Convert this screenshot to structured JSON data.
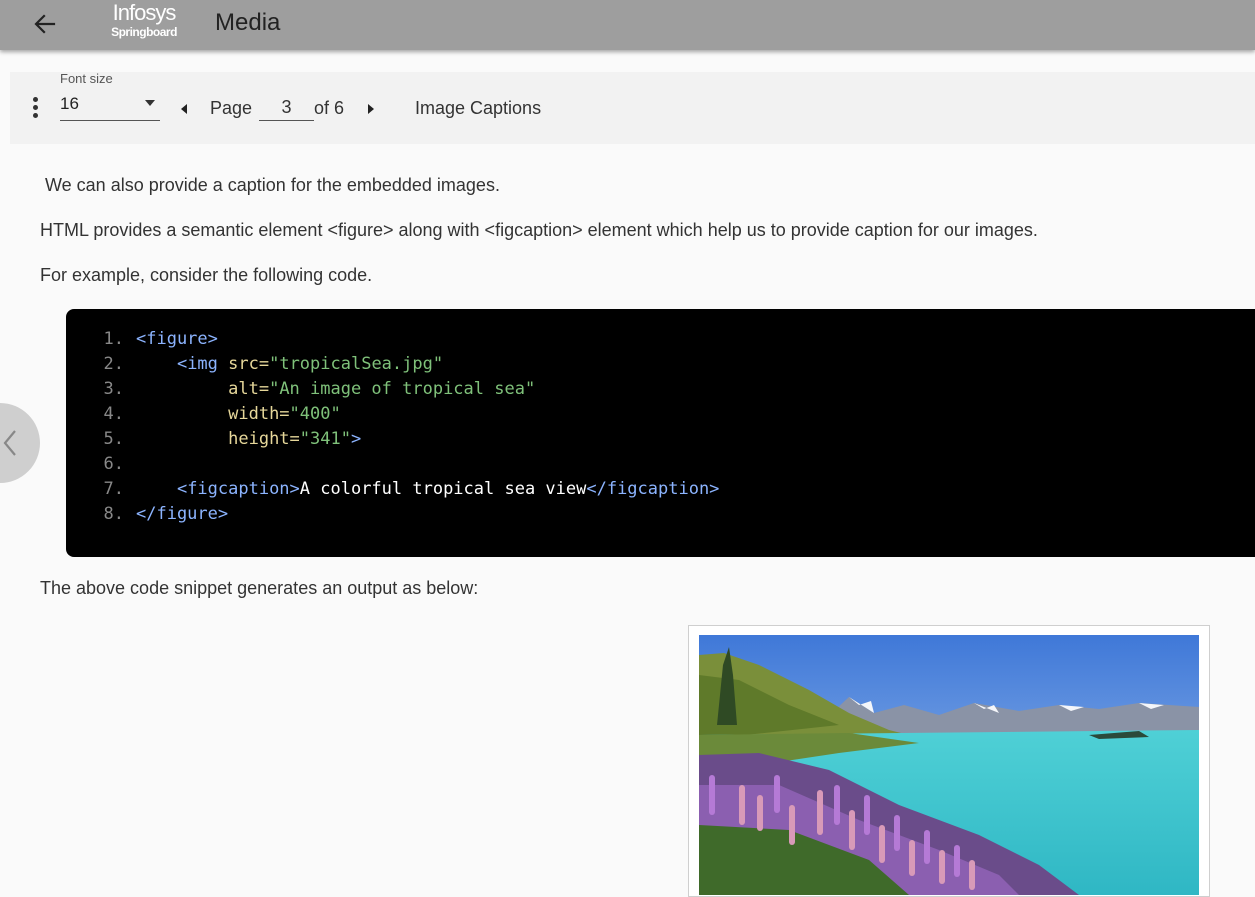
{
  "header": {
    "logo_line1": "Infosys",
    "logo_line2": "Springboard",
    "title": "Media"
  },
  "toolbar": {
    "font_size_label": "Font size",
    "font_size_value": "16",
    "page_label": "Page",
    "page_current": "3",
    "page_of": "of 6",
    "section_title": "Image Captions"
  },
  "content": {
    "para1": "We can also provide a caption for the embedded images.",
    "para2": "HTML provides a semantic element <figure> along with <figcaption> element which help us to provide caption for our images.",
    "para3": "For example, consider the following code.",
    "para4": "The above code snippet generates an output as below:"
  },
  "code": {
    "line_numbers": [
      "1.",
      "2.",
      "3.",
      "4.",
      "5.",
      "6.",
      "7.",
      "8."
    ],
    "l1_tag": "<figure>",
    "l2_indent": "    ",
    "l2_tag": "<img",
    "l2_attr": " src=",
    "l2_str": "\"tropicalSea.jpg\"",
    "l3_indent": "         ",
    "l3_attr": "alt=",
    "l3_str": "\"An image of tropical sea\"",
    "l4_indent": "         ",
    "l4_attr": "width=",
    "l4_str": "\"400\"",
    "l5_indent": "         ",
    "l5_attr": "height=",
    "l5_str": "\"341\"",
    "l5_tag": ">",
    "l7_indent": "    ",
    "l7_open": "<figcaption>",
    "l7_text": "A colorful tropical sea view",
    "l7_close": "</figcaption>",
    "l8_tag": "</figure>"
  },
  "colors": {
    "topbar": "#9e9e9e",
    "code_background": "#000000",
    "code_tag": "#8cb4ff",
    "code_attr": "#e6d79a",
    "code_string": "#7fc17a"
  },
  "icons": {
    "back": "arrow-left-icon",
    "menu": "more-vertical-icon",
    "prev": "caret-left-icon",
    "next": "caret-right-icon",
    "side_prev": "chevron-left-icon"
  }
}
